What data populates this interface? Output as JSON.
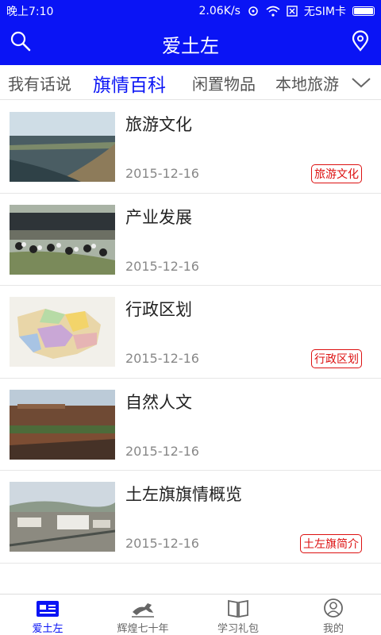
{
  "status_bar": {
    "time": "晚上7:10",
    "speed": "2.06K/s",
    "sim": "无SIM卡"
  },
  "app_bar": {
    "title": "爱土左"
  },
  "tabs": [
    {
      "label": "我有话说"
    },
    {
      "label": "旗情百科",
      "active": true
    },
    {
      "label": "闲置物品"
    },
    {
      "label": "本地旅游"
    }
  ],
  "articles": [
    {
      "title": "旅游文化",
      "date": "2015-12-16",
      "tag": "旅游文化"
    },
    {
      "title": "产业发展",
      "date": "2015-12-16",
      "tag": ""
    },
    {
      "title": "行政区划",
      "date": "2015-12-16",
      "tag": "行政区划"
    },
    {
      "title": "自然人文",
      "date": "2015-12-16",
      "tag": ""
    },
    {
      "title": "土左旗旗情概览",
      "date": "2015-12-16",
      "tag": "土左旗简介"
    }
  ],
  "bottom_nav": [
    {
      "label": "爱土左",
      "active": true
    },
    {
      "label": "辉煌七十年"
    },
    {
      "label": "学习礼包"
    },
    {
      "label": "我的"
    }
  ],
  "colors": {
    "primary": "#0a14f5",
    "tag": "#dd1111"
  }
}
